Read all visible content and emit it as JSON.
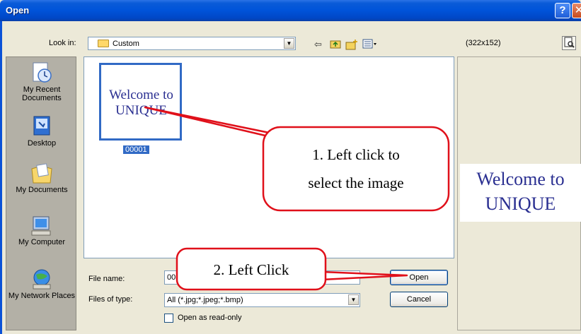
{
  "window": {
    "title": "Open",
    "help_symbol": "?",
    "close_symbol": "✕"
  },
  "toolbar": {
    "lookin_label": "Look in:",
    "lookin_value": "Custom",
    "back_icon": "back-arrow-icon",
    "up_icon": "up-folder-icon",
    "new_folder_icon": "new-folder-icon",
    "views_icon": "views-menu-icon",
    "image_dims": "(322x152)",
    "preview_icon": "preview-icon"
  },
  "places": [
    {
      "label": "My Recent Documents",
      "icon": "recent-documents-icon"
    },
    {
      "label": "Desktop",
      "icon": "desktop-icon"
    },
    {
      "label": "My Documents",
      "icon": "my-documents-icon"
    },
    {
      "label": "My Computer",
      "icon": "my-computer-icon"
    },
    {
      "label": "My Network Places",
      "icon": "network-places-icon"
    }
  ],
  "files": [
    {
      "name": "00001",
      "thumb_text": "Welcome to UNIQUE",
      "selected": true
    }
  ],
  "preview": {
    "text": "Welcome to UNIQUE"
  },
  "form": {
    "file_name_label": "File name:",
    "file_name_value": "00",
    "files_of_type_label": "Files of type:",
    "files_of_type_value": "All (*.jpg;*.jpeg;*.bmp)",
    "open_button": "Open",
    "cancel_button": "Cancel",
    "read_only_label": "Open as read-only",
    "read_only_checked": false
  },
  "annotations": {
    "step1_line1": "1. Left click to",
    "step1_line2": "select the image",
    "step2": "2. Left Click"
  },
  "colors": {
    "titlebar": "#0053d9",
    "selection": "#316ac5",
    "callout_border": "#e0101a",
    "thumb_text": "#2a2f91"
  }
}
